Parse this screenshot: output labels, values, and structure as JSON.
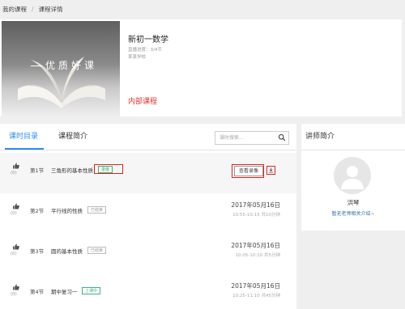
{
  "breadcrumb": {
    "items": [
      "我的课程",
      "课程详情"
    ],
    "separator": "/"
  },
  "course": {
    "cover_text": "优质好课",
    "title": "新初一数学",
    "progress_text": "直播进度：3/4节",
    "school_text": "某某学校",
    "tag": "内部课程"
  },
  "tabs": [
    {
      "label": "课时目录",
      "active": true
    },
    {
      "label": "课程简介",
      "active": false
    }
  ],
  "search": {
    "placeholder": "课时搜索...",
    "value": ""
  },
  "lessons": [
    {
      "likes": "(0)",
      "section": "第1节",
      "title": "三角形的基本性质",
      "badge": "录像",
      "badge_color": "green",
      "record_button": "查看录像",
      "date": "",
      "time": ""
    },
    {
      "likes": "(0)",
      "section": "第2节",
      "title": "平行线的性质",
      "badge": "已结束",
      "badge_color": "gray",
      "record_button": "",
      "date": "2017年05月16日",
      "time": "10:55-10:15 共10分钟"
    },
    {
      "likes": "(0)",
      "section": "第3节",
      "title": "圆的基本性质",
      "badge": "已结束",
      "badge_color": "gray",
      "record_button": "",
      "date": "2017年05月16日",
      "time": "10:05-10:10 共5分钟"
    },
    {
      "likes": "(0)",
      "section": "第4节",
      "title": "期中复习一",
      "badge": "上课中",
      "badge_color": "green",
      "record_button": "",
      "date": "2017年05月16日",
      "time": "10:25-11:10 共45分钟"
    }
  ],
  "teacher": {
    "heading": "讲师简介",
    "name": "洪琴",
    "intro": "暂无老师相关介绍~"
  },
  "colors": {
    "accent": "#2d8cf0",
    "highlight": "#d9251d",
    "green": "#3fb27f",
    "tag_red": "#e0312b"
  },
  "icons": {
    "thumb": "thumbs-up-icon",
    "search": "search-icon",
    "download": "download-icon",
    "avatar": "user-avatar-icon"
  }
}
